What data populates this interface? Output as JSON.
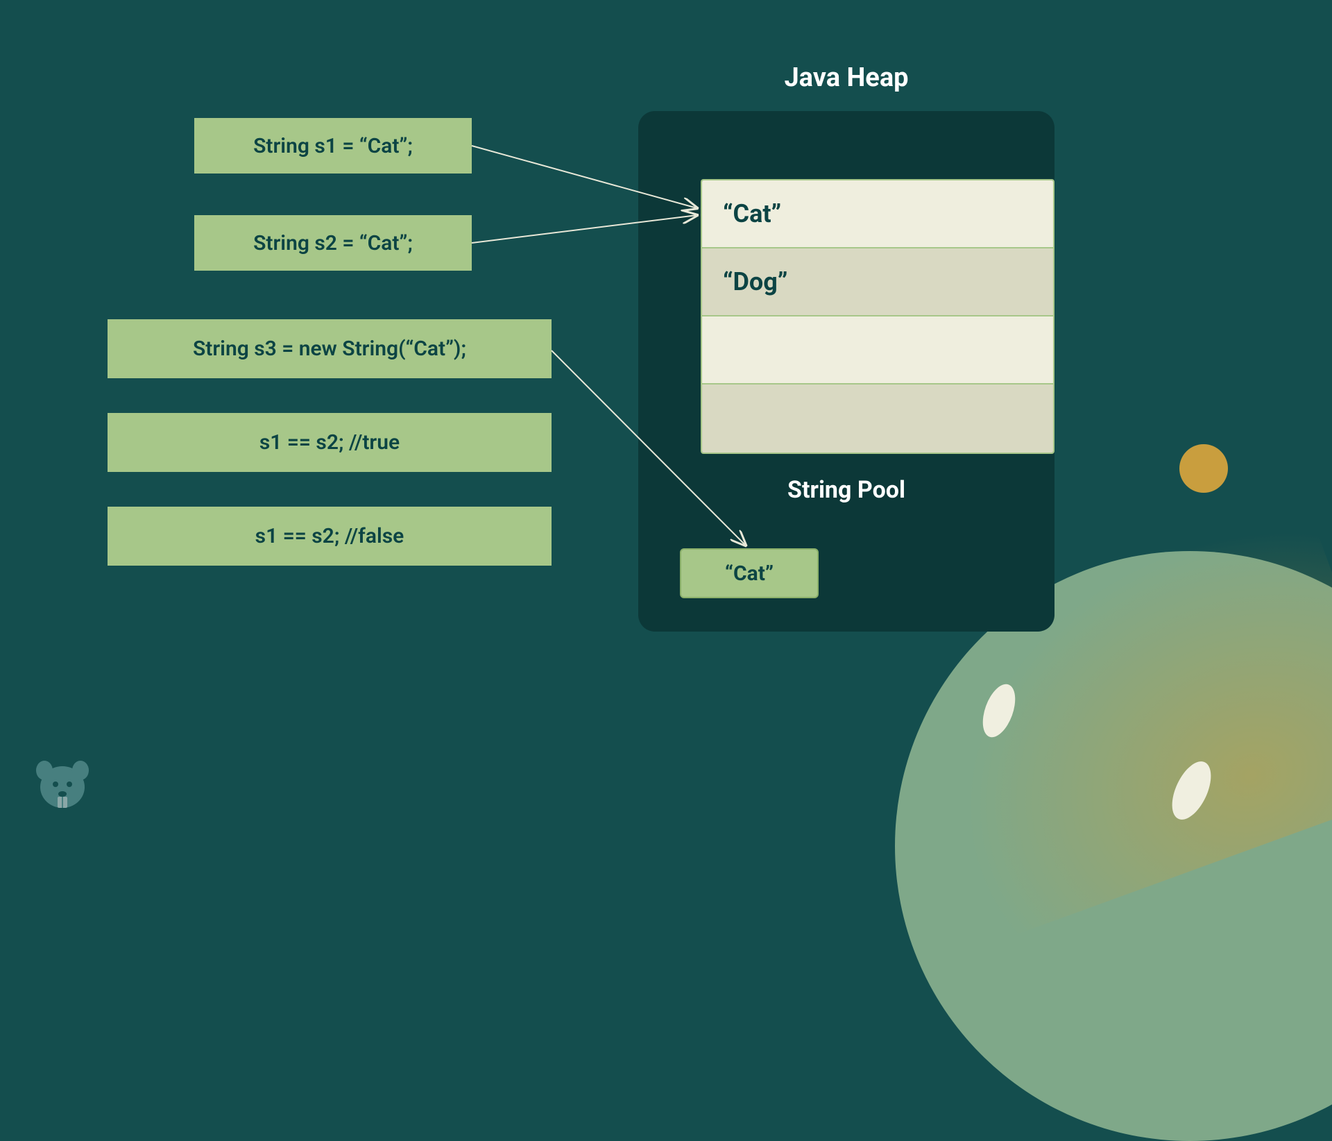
{
  "code_lines": {
    "s1_decl": "String s1 = “Cat”;",
    "s2_decl": "String s2 = “Cat”;",
    "s3_decl": "String s3 = new String(“Cat”);",
    "cmp1": "s1 == s2; //true",
    "cmp2": "s1 == s2; //false"
  },
  "heap": {
    "title": "Java Heap",
    "string_pool_title": "String Pool",
    "pool_entries": {
      "row1": "“Cat”",
      "row2": "“Dog”",
      "row3": "",
      "row4": ""
    },
    "heap_object": "“Cat”"
  }
}
